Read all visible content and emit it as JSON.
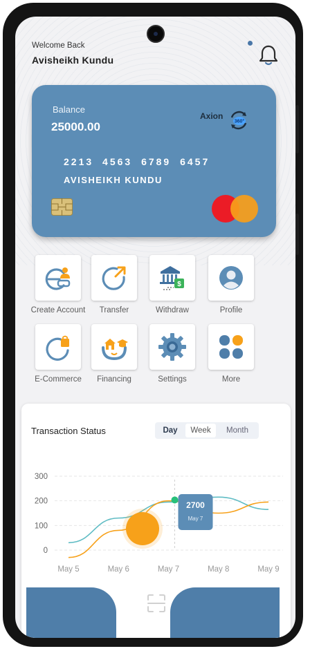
{
  "header": {
    "welcome_text": "Welcome Back",
    "user_name": "Avisheikh  Kundu"
  },
  "card": {
    "label": "Balance",
    "balance": "25000.00",
    "brand": "Axion",
    "brand_badge": "360°",
    "number": "2213 4563 6789 6457",
    "holder": "AVISHEIKH KUNDU"
  },
  "services": [
    {
      "label": "Create Account",
      "icon": "create-account-icon"
    },
    {
      "label": "Transfer",
      "icon": "transfer-icon"
    },
    {
      "label": "Withdraw",
      "icon": "bank-withdraw-icon"
    },
    {
      "label": "Profile",
      "icon": "profile-icon"
    },
    {
      "label": "E-Commerce",
      "icon": "shopping-bag-icon"
    },
    {
      "label": "Financing",
      "icon": "home-financing-icon"
    },
    {
      "label": "Settings",
      "icon": "gear-icon"
    },
    {
      "label": "More",
      "icon": "grid-icon"
    }
  ],
  "transactions": {
    "title": "Transaction Status",
    "tabs": [
      "Day",
      "Week",
      "Month"
    ],
    "active_tab": "Day",
    "tooltip_value": "2700",
    "tooltip_label": "May 7"
  },
  "colors": {
    "primary": "#5c8db6",
    "accent_orange": "#f7a11a",
    "line_teal": "#5fbcc4",
    "highlight_green": "#27c07a"
  },
  "chart_data": {
    "type": "line",
    "x": [
      "May 5",
      "May 6",
      "May 7",
      "May 8",
      "May 9"
    ],
    "y_ticks": [
      0,
      100,
      200,
      300
    ],
    "ylim": [
      0,
      300
    ],
    "series": [
      {
        "values": [
          30,
          130,
          195,
          215,
          165
        ]
      },
      {
        "values": [
          -30,
          80,
          200,
          150,
          195
        ]
      }
    ],
    "highlight": {
      "x": "May 7",
      "value": 2700
    }
  }
}
